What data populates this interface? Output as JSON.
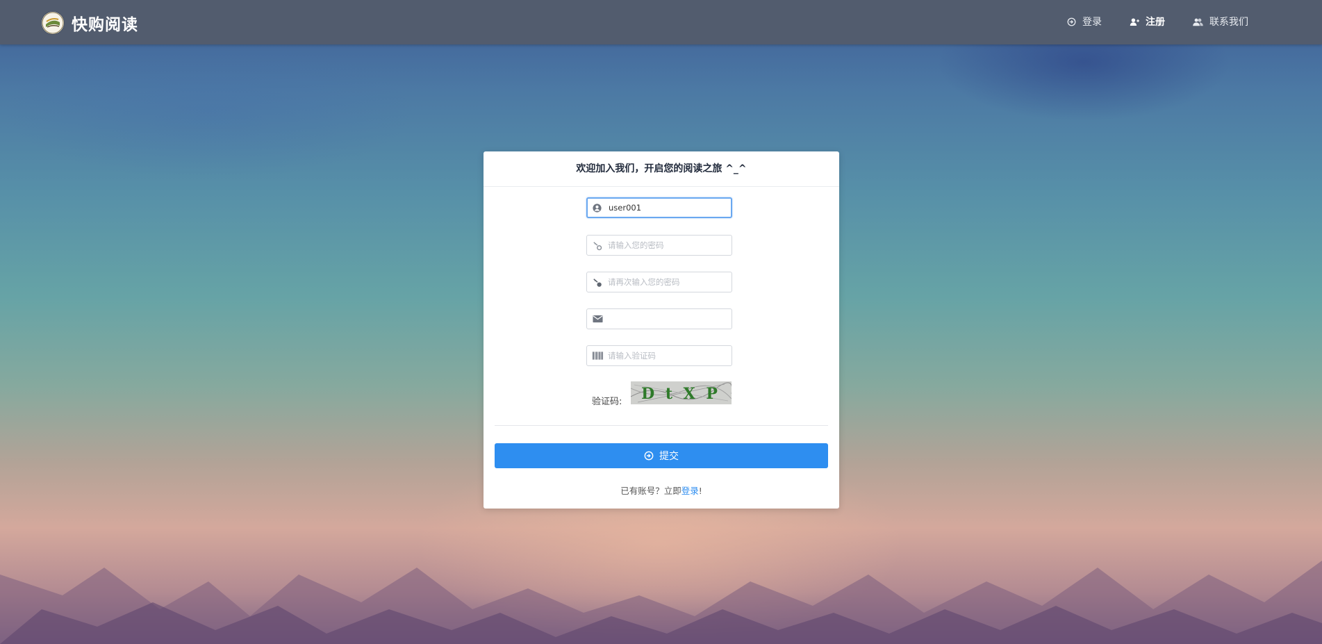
{
  "header": {
    "brand_name": "快购阅读",
    "nav": [
      {
        "label": "登录",
        "icon": "login-icon"
      },
      {
        "label": "注册",
        "icon": "add-user-icon",
        "active": true
      },
      {
        "label": "联系我们",
        "icon": "contact-icon"
      }
    ]
  },
  "form": {
    "title": "欢迎加入我们，开启您的阅读之旅 ^_^",
    "username": {
      "value": "user001",
      "icon": "user-circle-icon"
    },
    "password": {
      "placeholder": "请输入您的密码",
      "icon": "key-icon"
    },
    "confirm_password": {
      "placeholder": "请再次输入您的密码",
      "icon": "key-icon"
    },
    "email": {
      "value": "",
      "icon": "envelope-icon"
    },
    "captcha_input": {
      "placeholder": "请输入验证码",
      "icon": "barcode-icon"
    },
    "captcha_label": "验证码:",
    "captcha_text": "D t X P",
    "submit_label": "提交",
    "footer_prefix": "已有账号？立即",
    "footer_link": "登录",
    "footer_suffix": "!"
  },
  "colors": {
    "topbar": "#525c6e",
    "primary": "#2e8ef0",
    "focus_border": "#6aa8f0"
  }
}
